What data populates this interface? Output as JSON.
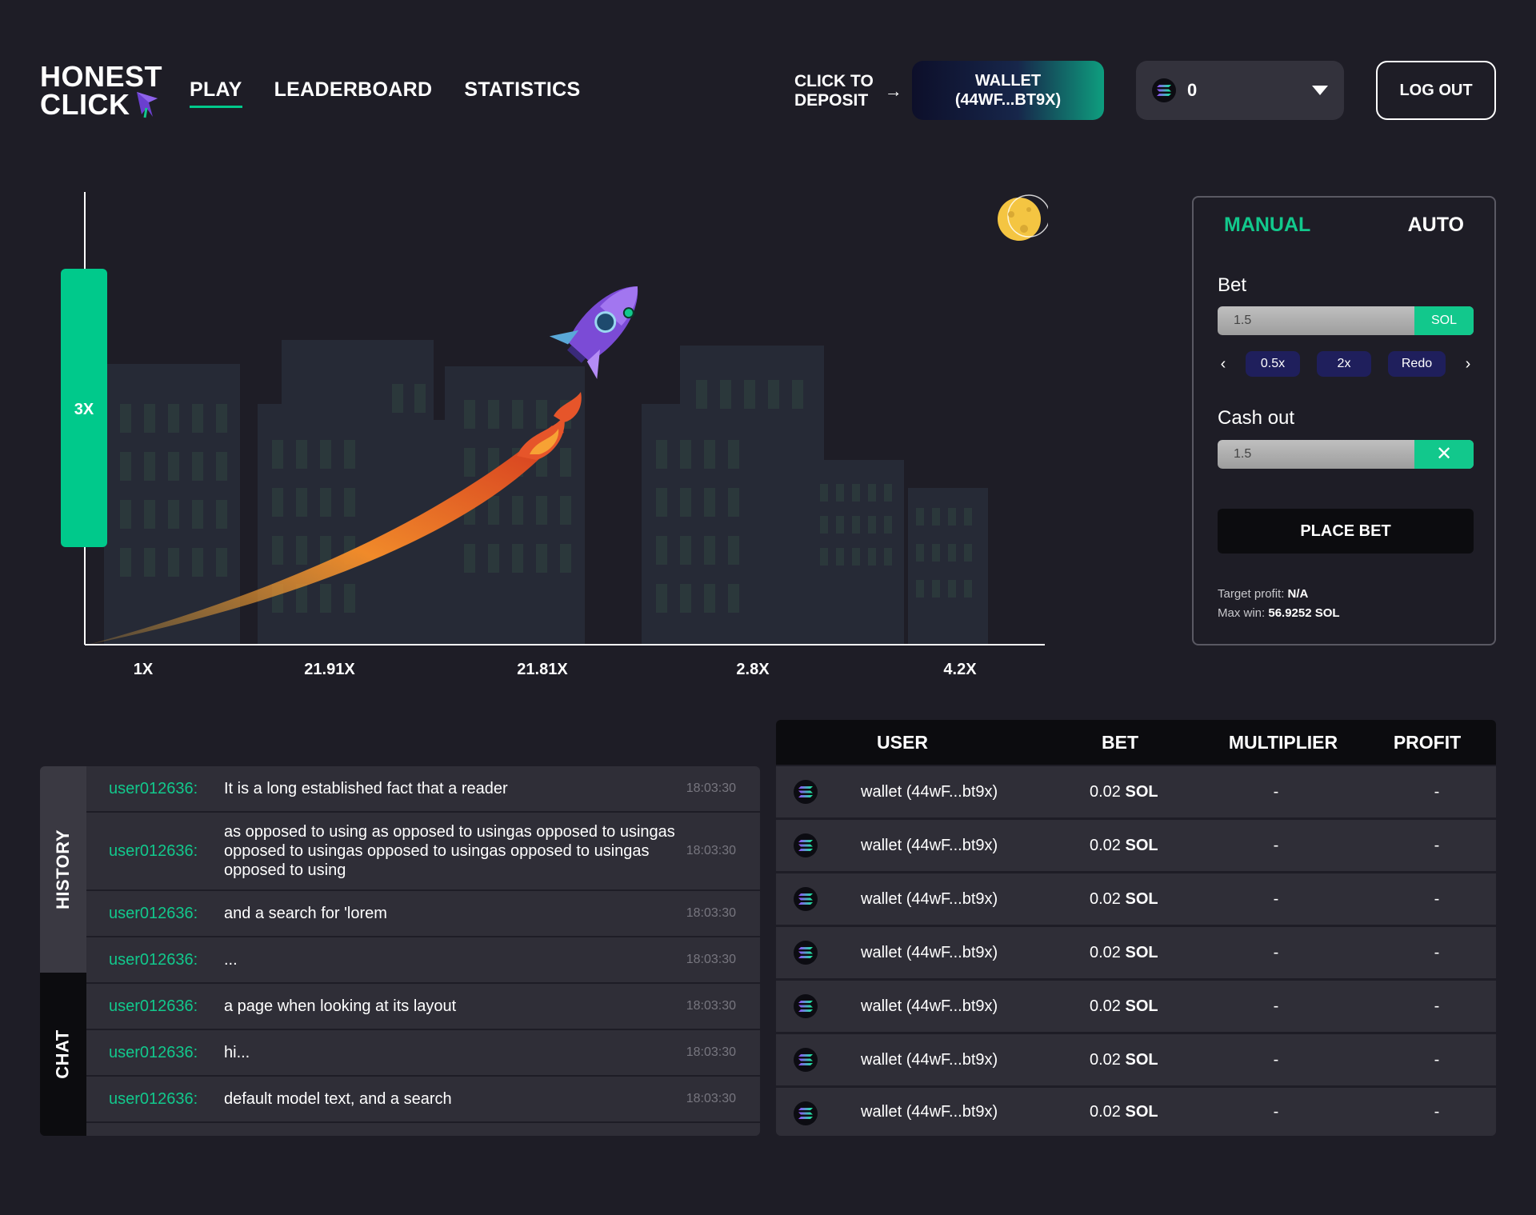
{
  "header": {
    "logo_line1": "HONEST",
    "logo_line2": "CLICK",
    "nav": [
      "PLAY",
      "LEADERBOARD",
      "STATISTICS"
    ],
    "deposit_line1": "CLICK TO",
    "deposit_line2": "DEPOSIT",
    "deposit_arrow": "→",
    "wallet_line1": "WALLET",
    "wallet_line2": "(44WF...BT9X)",
    "balance": "0",
    "logout": "LOG OUT"
  },
  "game": {
    "multiplier_badge": "3X",
    "x_labels": [
      "1X",
      "21.91X",
      "21.81X",
      "2.8X",
      "4.2X"
    ],
    "accent_color": "#12c88c"
  },
  "bet_panel": {
    "tab_manual": "MANUAL",
    "tab_auto": "AUTO",
    "bet_label": "Bet",
    "bet_value": "1.5",
    "bet_unit": "SOL",
    "quick": [
      "0.5x",
      "2x",
      "Redo"
    ],
    "prev": "‹",
    "next": "›",
    "cashout_label": "Cash out",
    "cashout_value": "1.5",
    "cashout_clear": "✕",
    "place_bet": "PLACE BET",
    "target_profit_label": "Target profit:",
    "target_profit_value": "N/A",
    "max_win_label": "Max win:",
    "max_win_value": "56.9252 SOL"
  },
  "side_tabs": {
    "history": "HISTORY",
    "chat": "CHAT"
  },
  "chat": [
    {
      "user": "user012636:",
      "text": "It is a long established fact that a reader",
      "time": "18:03:30"
    },
    {
      "user": "user012636:",
      "text": "as opposed to using as opposed to usingas opposed to usingas opposed to usingas opposed to usingas opposed to usingas opposed to using",
      "time": "18:03:30"
    },
    {
      "user": "user012636:",
      "text": "and a search for 'lorem",
      "time": "18:03:30"
    },
    {
      "user": "user012636:",
      "text": "...",
      "time": "18:03:30"
    },
    {
      "user": "user012636:",
      "text": "a page when looking at its layout",
      "time": "18:03:30"
    },
    {
      "user": "user012636:",
      "text": "hi...",
      "time": "18:03:30"
    },
    {
      "user": "user012636:",
      "text": "default model text, and a search",
      "time": "18:03:30"
    }
  ],
  "bets_table": {
    "columns": [
      "USER",
      "BET",
      "MULTIPLIER",
      "PROFIT"
    ],
    "rows": [
      {
        "user": "wallet  (44wF...bt9x)",
        "bet": "0.02",
        "unit": "SOL",
        "multiplier": "-",
        "profit": "-"
      },
      {
        "user": "wallet  (44wF...bt9x)",
        "bet": "0.02",
        "unit": "SOL",
        "multiplier": "-",
        "profit": "-"
      },
      {
        "user": "wallet  (44wF...bt9x)",
        "bet": "0.02",
        "unit": "SOL",
        "multiplier": "-",
        "profit": "-"
      },
      {
        "user": "wallet  (44wF...bt9x)",
        "bet": "0.02",
        "unit": "SOL",
        "multiplier": "-",
        "profit": "-"
      },
      {
        "user": "wallet  (44wF...bt9x)",
        "bet": "0.02",
        "unit": "SOL",
        "multiplier": "-",
        "profit": "-"
      },
      {
        "user": "wallet  (44wF...bt9x)",
        "bet": "0.02",
        "unit": "SOL",
        "multiplier": "-",
        "profit": "-"
      },
      {
        "user": "wallet  (44wF...bt9x)",
        "bet": "0.02",
        "unit": "SOL",
        "multiplier": "-",
        "profit": "-"
      }
    ]
  }
}
